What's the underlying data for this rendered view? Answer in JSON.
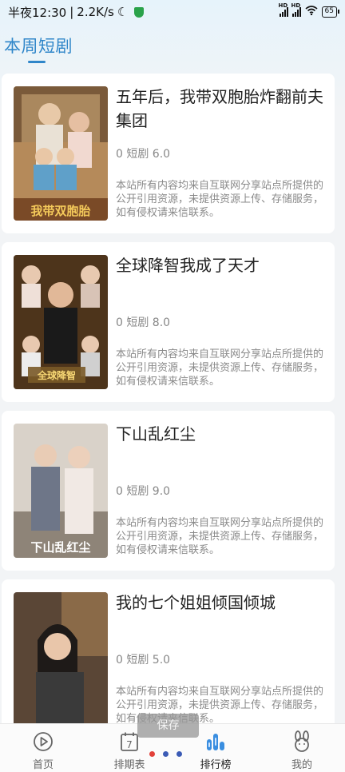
{
  "status_bar": {
    "time": "半夜12:30",
    "speed": "2.2K/s",
    "net_label_1": "HD",
    "net_label_2": "HD",
    "battery": "65"
  },
  "section": {
    "title": "本周短剧"
  },
  "dramas": [
    {
      "title": "五年后，我带双胞胎炸翻前夫集团",
      "meta": "0 短剧 6.0",
      "desc": "本站所有内容均来自互联网分享站点所提供的公开引用资源，未提供资源上传、存储服务，如有侵权请来信联系。",
      "poster_caption": "我带双胞胎"
    },
    {
      "title": "全球降智我成了天才",
      "meta": "0 短剧 8.0",
      "desc": "本站所有内容均来自互联网分享站点所提供的公开引用资源，未提供资源上传、存储服务，如有侵权请来信联系。",
      "poster_caption": "全球降智"
    },
    {
      "title": "下山乱红尘",
      "meta": "0 短剧 9.0",
      "desc": "本站所有内容均来自互联网分享站点所提供的公开引用资源，未提供资源上传、存储服务，如有侵权请来信联系。",
      "poster_caption": "下山乱红尘"
    },
    {
      "title": "我的七个姐姐倾国倾城",
      "meta": "0 短剧 5.0",
      "desc": "本站所有内容均来自互联网分享站点所提供的公开引用资源，未提供资源上传、存储服务，如有侵权请来信联系。",
      "poster_caption": ""
    }
  ],
  "toast": "保存",
  "nav": [
    {
      "label": "首页",
      "icon": "play-circle-icon"
    },
    {
      "label": "排期表",
      "icon": "calendar-icon"
    },
    {
      "label": "排行榜",
      "icon": "ranking-bars-icon",
      "active": true
    },
    {
      "label": "我的",
      "icon": "rabbit-icon"
    }
  ],
  "colors": {
    "accent": "#2f86c9",
    "dot_1": "#e2413a",
    "dot_2": "#3b5bb5",
    "dot_3": "#3b5bb5"
  }
}
